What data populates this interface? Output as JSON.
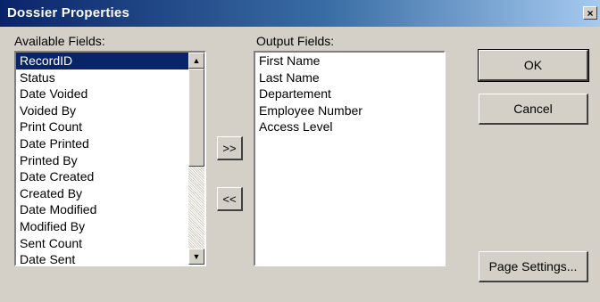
{
  "window": {
    "title": "Dossier Properties",
    "close_glyph": "×"
  },
  "available": {
    "label": "Available Fields:",
    "items": [
      "RecordID",
      "Status",
      "Date Voided",
      "Voided By",
      "Print Count",
      "Date Printed",
      "Printed By",
      "Date Created",
      "Created By",
      "Date Modified",
      "Modified By",
      "Sent Count",
      "Date Sent"
    ],
    "selected_index": 0
  },
  "output": {
    "label": "Output Fields:",
    "items": [
      "First Name",
      "Last Name",
      "Departement",
      "Employee Number",
      "Access Level"
    ]
  },
  "buttons": {
    "add": ">>",
    "remove": "<<",
    "ok": "OK",
    "cancel": "Cancel",
    "page_settings": "Page Settings..."
  },
  "scrollbar": {
    "up_glyph": "▲",
    "down_glyph": "▼"
  }
}
